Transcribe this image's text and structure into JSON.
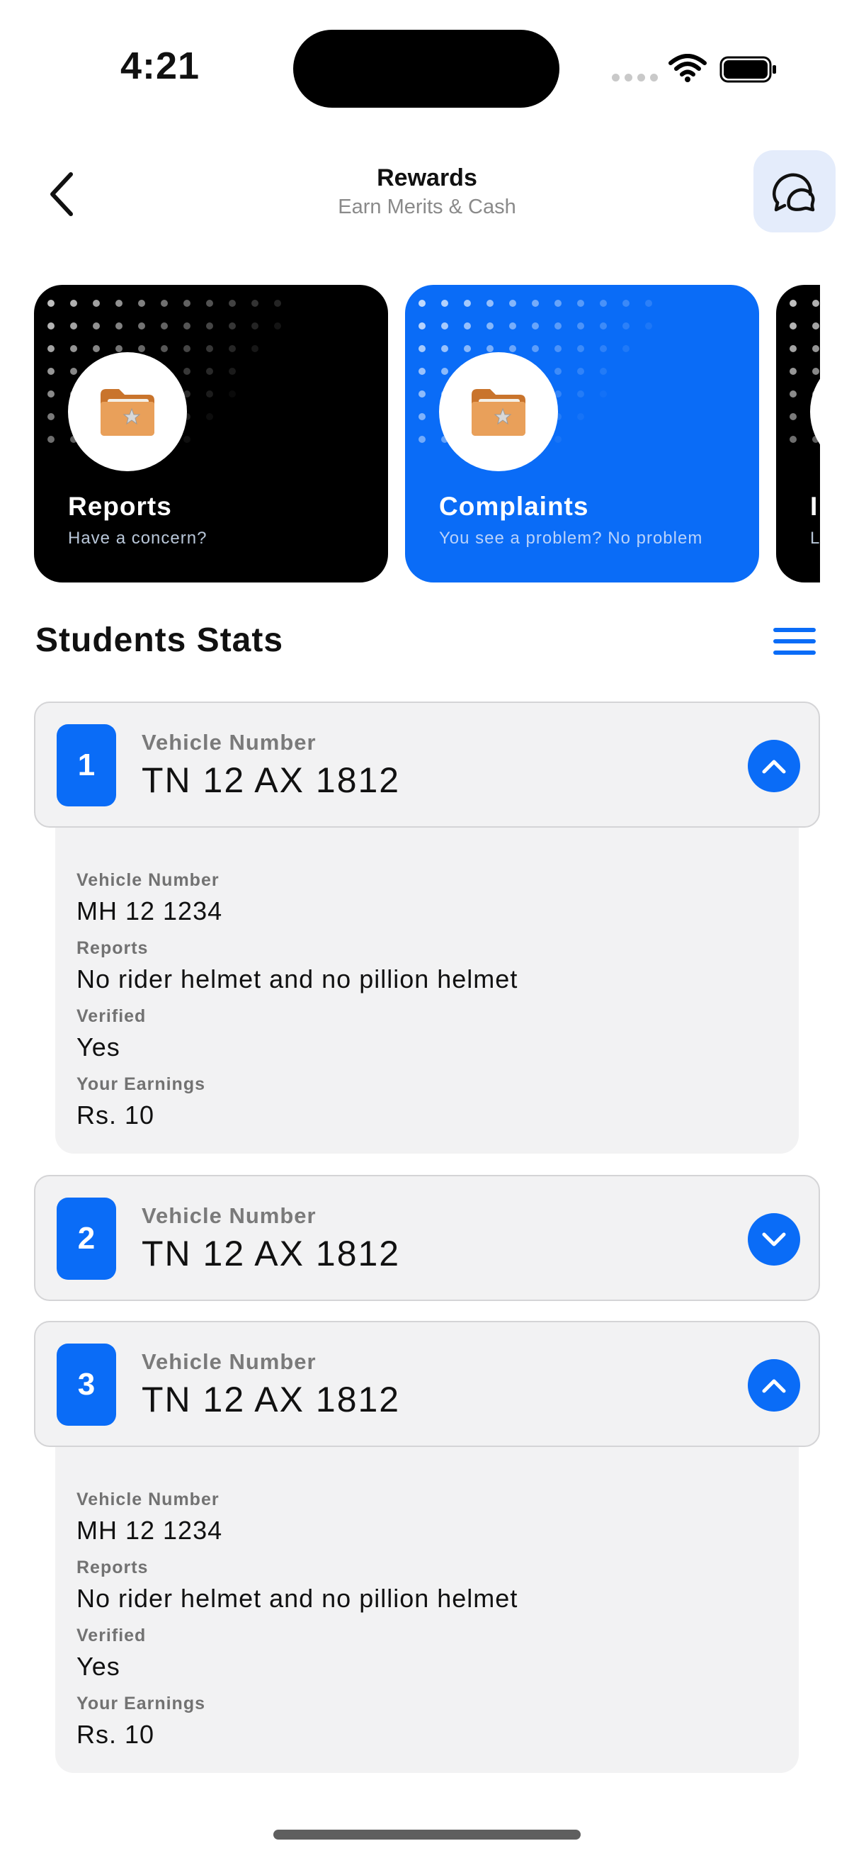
{
  "status_bar": {
    "time": "4:21"
  },
  "header": {
    "title": "Rewards",
    "subtitle": "Earn Merits & Cash"
  },
  "cards": [
    {
      "title": "Reports",
      "subtitle": "Have a concern?",
      "color": "#000000",
      "icon": "folder-star-icon"
    },
    {
      "title": "Complaints",
      "subtitle": "You see a problem? No problem",
      "color": "#0A6CF7",
      "icon": "folder-star-icon"
    },
    {
      "title": "I",
      "subtitle": "L",
      "color": "#000000",
      "icon": "folder-star-icon"
    }
  ],
  "section": {
    "title": "Students Stats"
  },
  "items": [
    {
      "number": "1",
      "label": "Vehicle Number",
      "value": "TN 12 AX 1812",
      "expanded": true,
      "details": [
        {
          "label": "Vehicle Number",
          "value": "MH 12 1234"
        },
        {
          "label": "Reports",
          "value": "No rider helmet and no pillion helmet"
        },
        {
          "label": "Verified",
          "value": "Yes"
        },
        {
          "label": "Your Earnings",
          "value": "Rs. 10"
        }
      ]
    },
    {
      "number": "2",
      "label": "Vehicle Number",
      "value": "TN 12 AX 1812",
      "expanded": false
    },
    {
      "number": "3",
      "label": "Vehicle Number",
      "value": "TN 12 AX 1812",
      "expanded": true,
      "details": [
        {
          "label": "Vehicle Number",
          "value": "MH 12 1234"
        },
        {
          "label": "Reports",
          "value": "No rider helmet and no pillion helmet"
        },
        {
          "label": "Verified",
          "value": "Yes"
        },
        {
          "label": "Your Earnings",
          "value": "Rs. 10"
        }
      ]
    }
  ],
  "colors": {
    "accent": "#0A6CF7",
    "card_bg": "#F2F2F3",
    "support_bg": "#E4ECFB"
  }
}
